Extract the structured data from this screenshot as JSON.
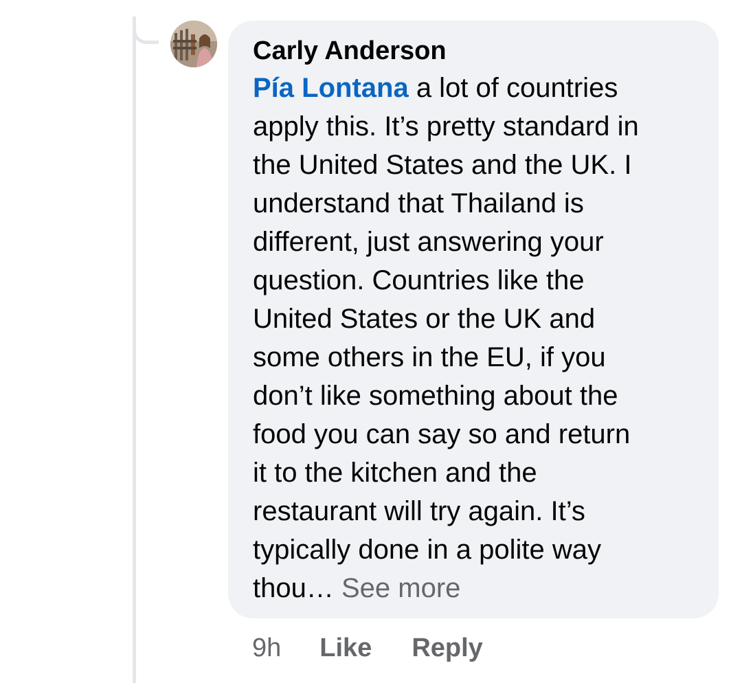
{
  "comment": {
    "author": "Carly Anderson",
    "mention": "Pía Lontana",
    "lines": [
      " a lot of countries",
      "apply this. It’s pretty standard in",
      "the United States and the UK. I",
      "understand that Thailand is",
      "different, just answering your",
      "question. Countries like the",
      "United States or the UK and",
      "some others in the EU, if you",
      "don’t like something about the",
      "food you can say so and return",
      "it to the kitchen and the",
      "restaurant will try again. It’s",
      "typically done in a polite way",
      "thou… "
    ],
    "see_more": "See more"
  },
  "actions": {
    "time": "9h",
    "like": "Like",
    "reply": "Reply"
  },
  "colors": {
    "bubble_background": "#f0f2f5",
    "mention": "#0a66c2",
    "secondary_text": "#65676b",
    "thread_line": "#e4e6eb"
  }
}
